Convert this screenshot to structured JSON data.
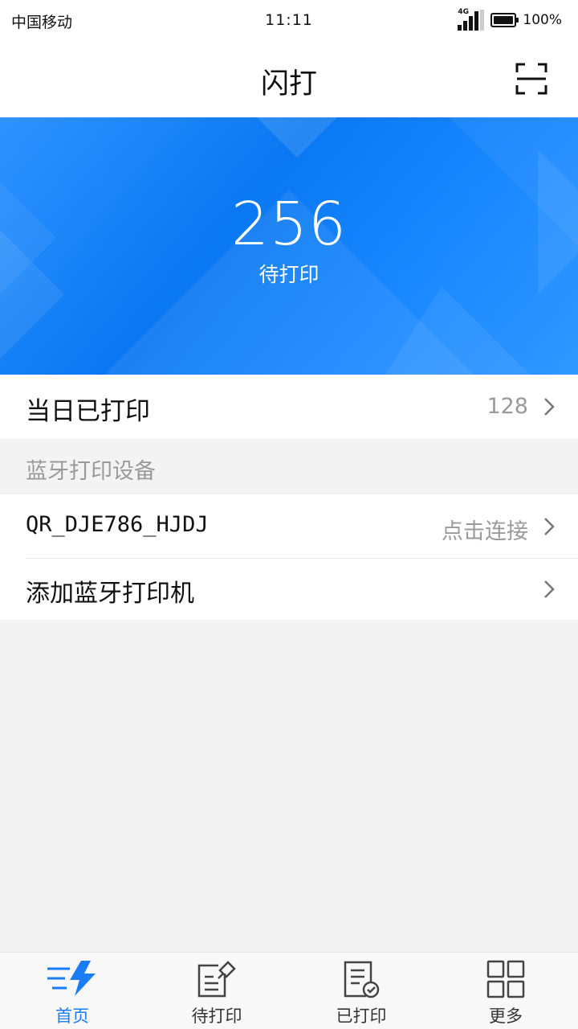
{
  "status_bar": {
    "carrier": "中国移动",
    "time": "11:11",
    "network": "4G",
    "battery": "100%"
  },
  "nav": {
    "title": "闪打",
    "scan_icon": "scan-icon"
  },
  "banner": {
    "count": "256",
    "label": "待打印"
  },
  "today_printed": {
    "label": "当日已打印",
    "value": "128"
  },
  "bluetooth_section": {
    "title": "蓝牙打印设备",
    "devices": [
      {
        "name": "QR_DJE786_HJDJ",
        "action": "点击连接"
      }
    ],
    "add_label": "添加蓝牙打印机"
  },
  "tabs": [
    {
      "label": "首页",
      "icon": "home-lightning-icon",
      "active": true
    },
    {
      "label": "待打印",
      "icon": "pending-print-icon",
      "active": false
    },
    {
      "label": "已打印",
      "icon": "printed-icon",
      "active": false
    },
    {
      "label": "更多",
      "icon": "grid-more-icon",
      "active": false
    }
  ],
  "colors": {
    "accent": "#1a7cf6",
    "banner": "#0a78f2",
    "secondary_text": "#9a9a9a"
  }
}
